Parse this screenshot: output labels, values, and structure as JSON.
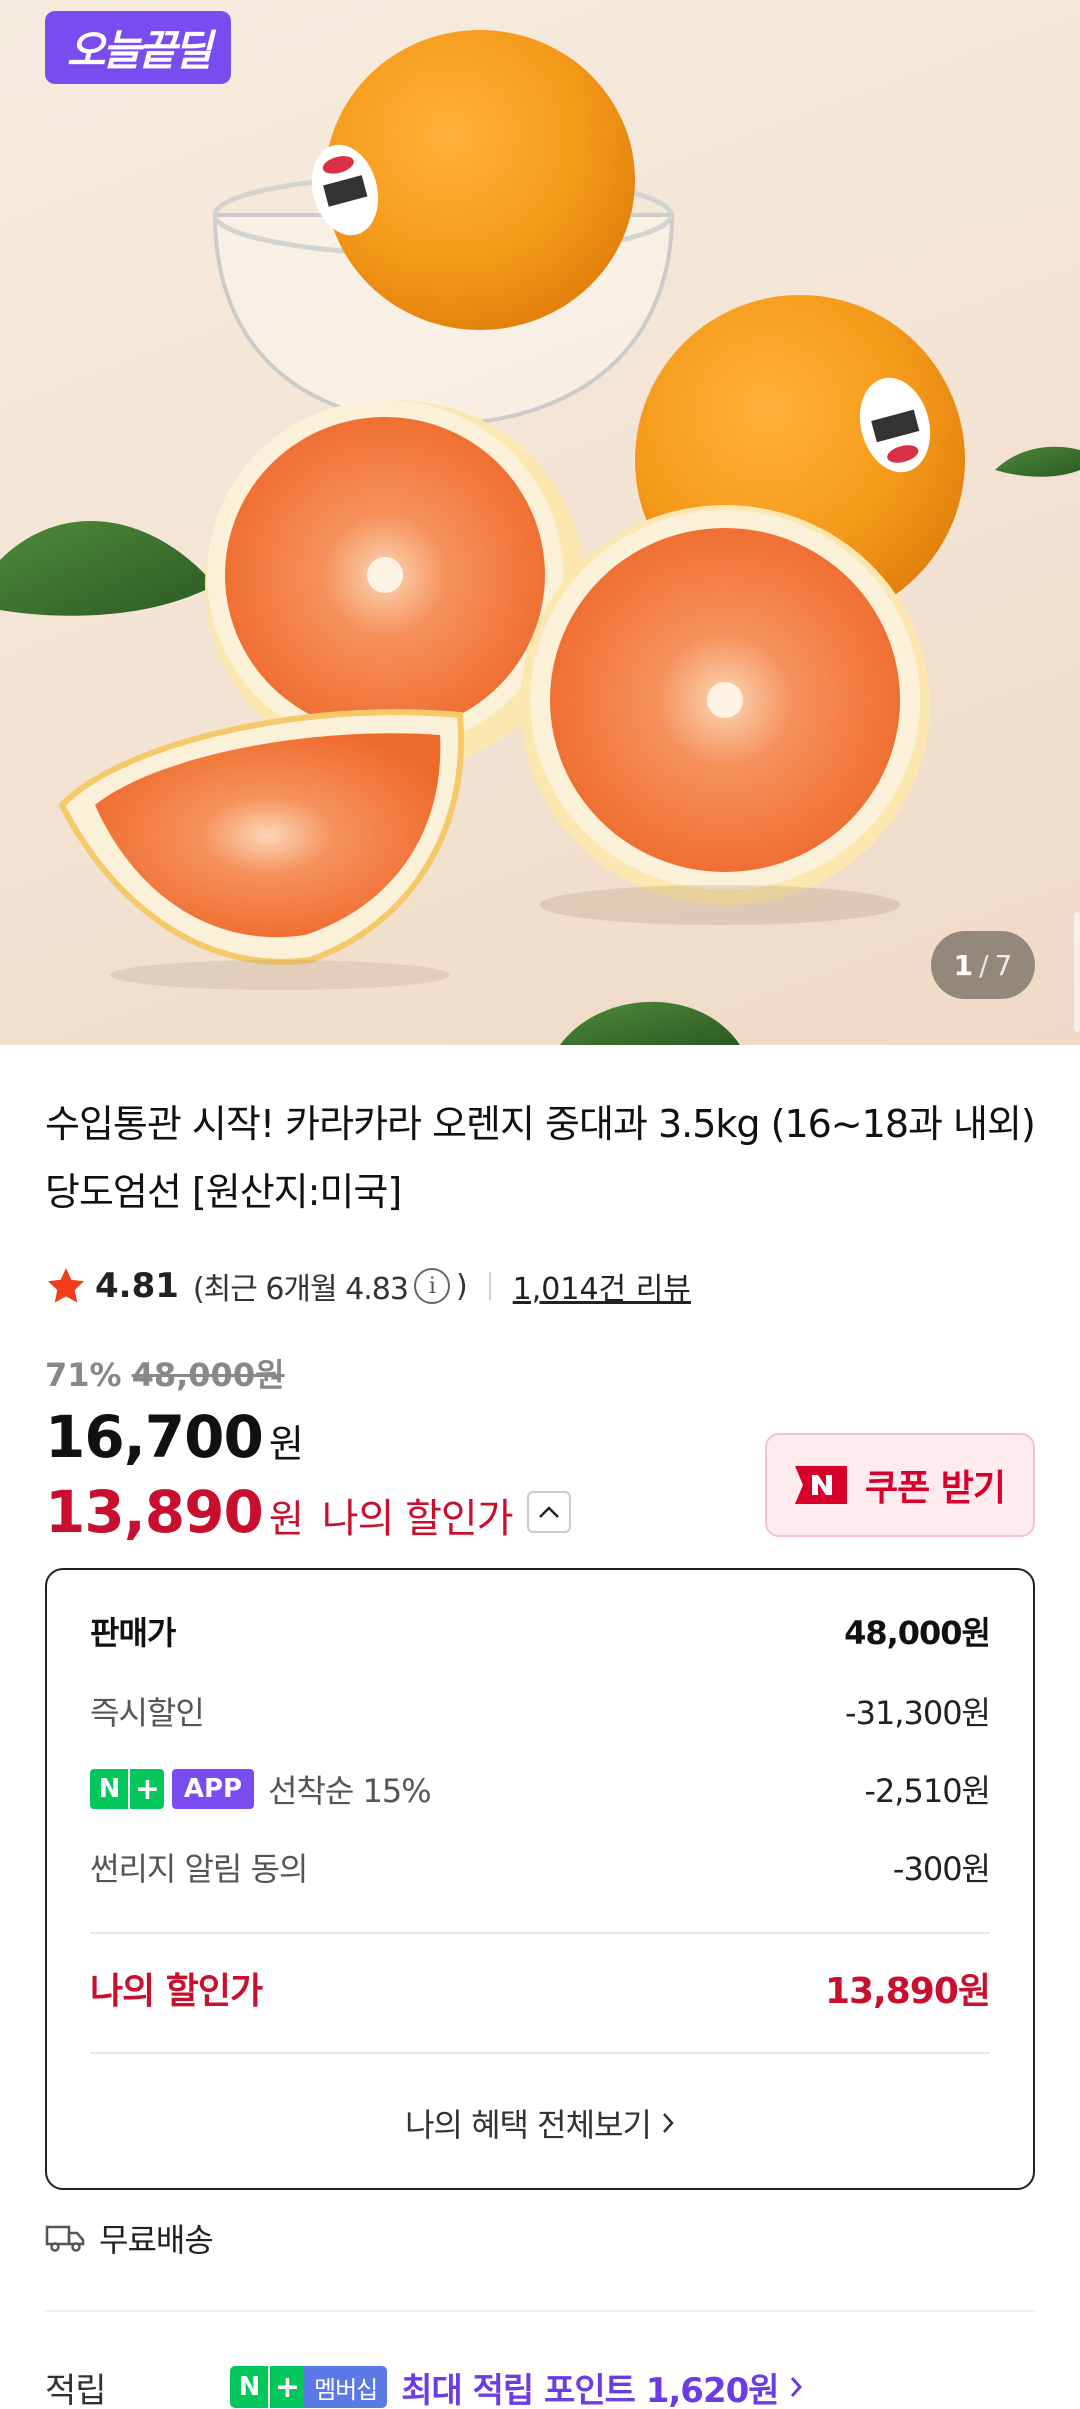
{
  "hero": {
    "badge_label": "오늘끝딜",
    "page_current": "1",
    "page_total": "7"
  },
  "product": {
    "title": "수입통관 시작! 카라카라 오렌지 중대과 3.5kg (16~18과 내외) 당도엄선 [원산지:미국]",
    "rating": "4.81",
    "recent_rating_text": "(최근 6개월 4.83",
    "recent_rating_close": ")",
    "review_count": "1,014건 리뷰"
  },
  "price": {
    "discount_rate": "71%",
    "original_price": "48,000원",
    "sale_price": "16,700",
    "sale_unit": "원",
    "my_price": "13,890",
    "my_unit": "원",
    "my_price_label": "나의 할인가",
    "coupon_label": "쿠폰 받기"
  },
  "breakdown": {
    "rows": [
      {
        "label": "판매가",
        "value": "48,000원"
      },
      {
        "label": "즉시할인",
        "value": "-31,300원"
      },
      {
        "label": "선착순 15%",
        "value": "-2,510원",
        "chip_n": "N",
        "chip_plus": "+",
        "chip_app": "APP"
      },
      {
        "label": "썬리지 알림 동의",
        "value": "-300원"
      }
    ],
    "total_label": "나의 할인가",
    "total_value": "13,890원",
    "more_label": "나의 혜택 전체보기"
  },
  "shipping": {
    "label": "무료배송"
  },
  "points": {
    "label": "적립",
    "badge_n": "N",
    "badge_plus": "+",
    "badge_text": "멤버십",
    "text": "최대 적립 포인트 1,620원"
  },
  "colors": {
    "accent_red": "#c8102e",
    "deal_purple": "#7a4cf0",
    "naver_green": "#03c75a",
    "points_purple": "#6b3be3"
  }
}
